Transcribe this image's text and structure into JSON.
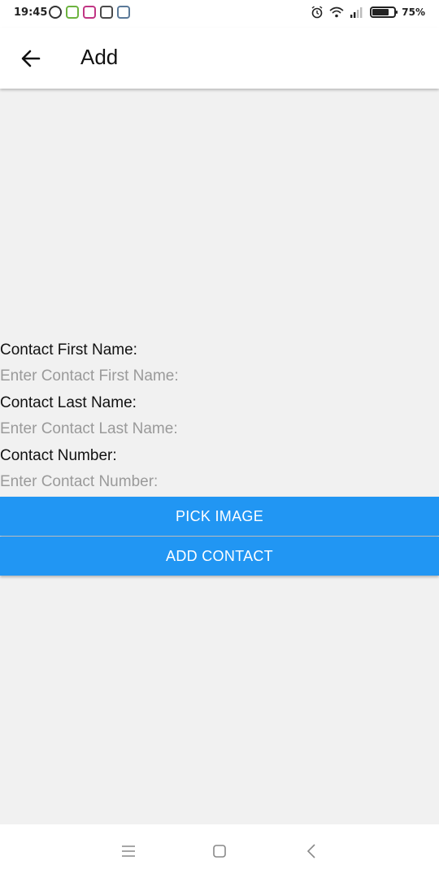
{
  "status_bar": {
    "time": "19:45",
    "battery_percent": "75%",
    "battery_level": 0.75,
    "notification_icons": [
      "vpn-icon",
      "android-icon",
      "instagram-icon",
      "google-icon",
      "message-icon"
    ],
    "status_icons": [
      "alarm-icon",
      "wifi-icon",
      "signal-icon",
      "battery-icon"
    ]
  },
  "app_bar": {
    "title": "Add",
    "back_icon": "arrow-left-icon"
  },
  "form": {
    "first_name": {
      "label": "Contact First Name:",
      "value": "",
      "placeholder": "Enter Contact First Name:"
    },
    "last_name": {
      "label": "Contact Last Name:",
      "value": "",
      "placeholder": "Enter Contact Last Name:"
    },
    "number": {
      "label": "Contact Number:",
      "value": "",
      "placeholder": "Enter Contact Number:"
    }
  },
  "buttons": {
    "pick_image": "PICK IMAGE",
    "add_contact": "ADD CONTACT"
  },
  "nav_bar": {
    "icons": [
      "menu-icon",
      "home-icon",
      "back-icon"
    ]
  },
  "colors": {
    "accent": "#2196f3",
    "background": "#f1f1f1",
    "app_bar": "#ffffff",
    "placeholder": "#9a9a9a"
  }
}
